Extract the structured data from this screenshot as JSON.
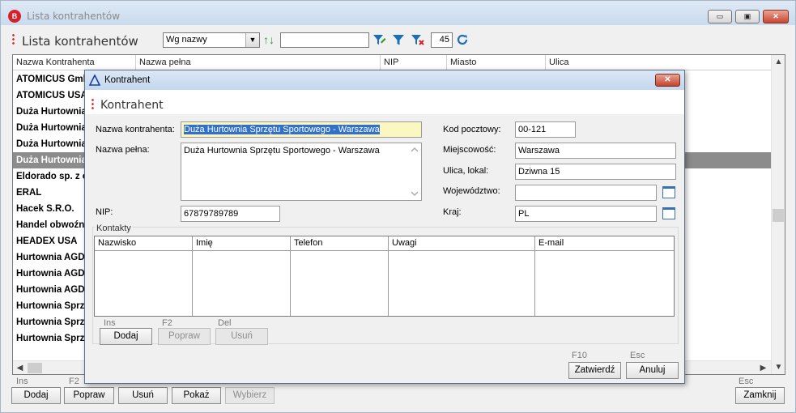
{
  "main_window": {
    "title": "Lista kontrahentów",
    "app_icon_letter": "B",
    "heading": "Lista kontrahentów",
    "controls": {
      "minimize": "▭",
      "restore": "▣",
      "close": "✕"
    }
  },
  "toolbar": {
    "sort_value": "Wg nazwy",
    "sort_arrow": "▼",
    "sort_direction_icon": "↑↓",
    "search_value": "",
    "count": "45",
    "icons": [
      "filter-edit-icon",
      "filter-icon",
      "filter-clear-icon",
      "refresh-icon"
    ]
  },
  "grid": {
    "columns": [
      "Nazwa Kontrahenta",
      "Nazwa pełna",
      "NIP",
      "Miasto",
      "Ulica"
    ],
    "rows": [
      "ATOMICUS GmbH",
      "ATOMICUS USA",
      "Duża Hurtownia",
      "Duża Hurtownia",
      "Duża Hurtownia",
      "Duża Hurtownia",
      "Eldorado sp. z o.o.",
      "ERAL",
      "Hacek S.R.O.",
      "Handel obwoźny",
      "HEADEX USA",
      "Hurtownia AGD",
      "Hurtownia AGD",
      "Hurtownia AGD",
      "Hurtownia Sprzętu",
      "Hurtownia Sprzętu",
      "Hurtownia Sprzętu"
    ],
    "selected_row": 5,
    "scroll_up": "▲",
    "scroll_down": "▼",
    "scroll_left": "◀",
    "scroll_right": "▶"
  },
  "bottom_bar": {
    "hotkeys": {
      "add": "Ins",
      "edit": "F2",
      "close": "Esc"
    },
    "buttons": {
      "add": "Dodaj",
      "edit": "Popraw",
      "delete": "Usuń",
      "show": "Pokaż",
      "choose": "Wybierz",
      "close": "Zamknij"
    }
  },
  "dialog": {
    "title": "Kontrahent",
    "heading": "Kontrahent",
    "close": "✕",
    "fields": {
      "nazwa_label": "Nazwa kontrahenta:",
      "nazwa_value": "Duża Hurtownia Sprzętu Sportowego - Warszawa",
      "pelna_label": "Nazwa pełna:",
      "pelna_value": "Duża Hurtownia Sprzętu Sportowego - Warszawa",
      "nip_label": "NIP:",
      "nip_value": "67879789789",
      "kod_label": "Kod pocztowy:",
      "kod_value": "00-121",
      "miejscowosc_label": "Miejscowość:",
      "miejscowosc_value": "Warszawa",
      "ulica_label": "Ulica, lokal:",
      "ulica_value": "Dziwna 15",
      "wojewodztwo_label": "Województwo:",
      "wojewodztwo_value": "",
      "kraj_label": "Kraj:",
      "kraj_value": "PL"
    },
    "contacts": {
      "legend": "Kontakty",
      "columns": [
        "Nazwisko",
        "Imię",
        "Telefon",
        "Uwagi",
        "E-mail"
      ],
      "hotkeys": {
        "add": "Ins",
        "edit": "F2",
        "delete": "Del"
      },
      "buttons": {
        "add": "Dodaj",
        "edit": "Popraw",
        "delete": "Usuń"
      }
    },
    "footer": {
      "hotkeys": {
        "confirm": "F10",
        "cancel": "Esc"
      },
      "buttons": {
        "confirm": "Zatwierdź",
        "cancel": "Anuluj"
      }
    }
  }
}
